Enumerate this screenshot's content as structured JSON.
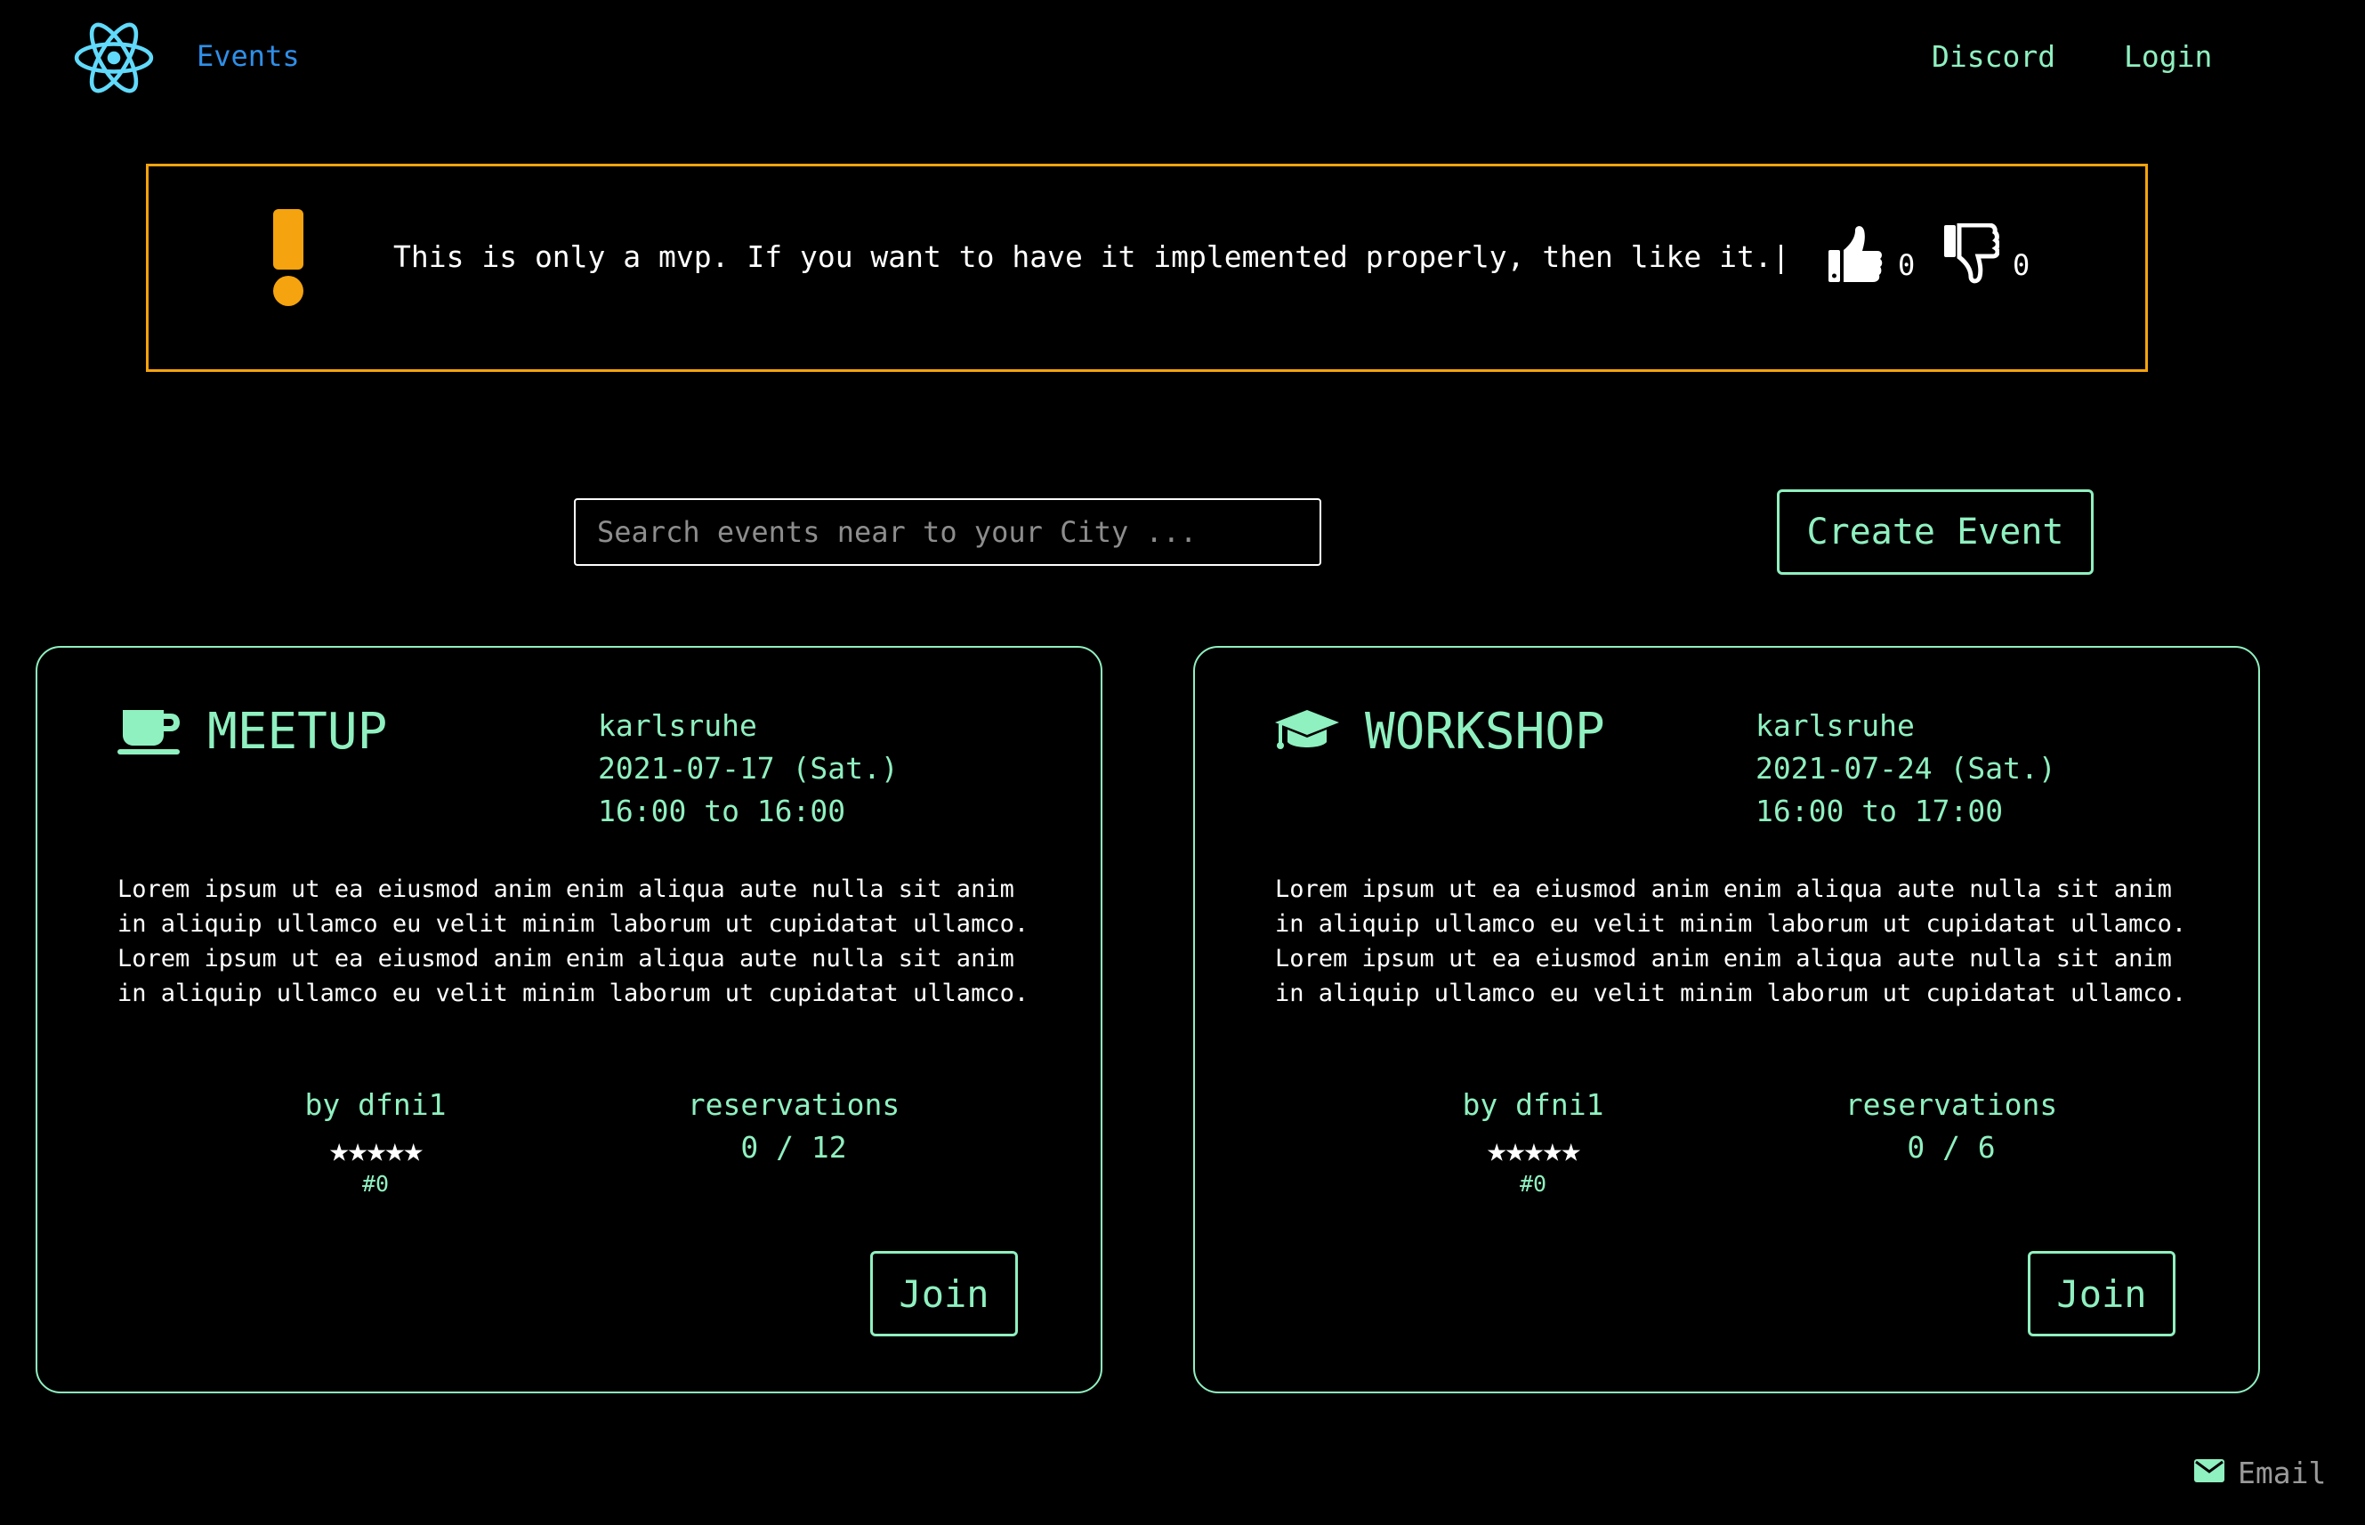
{
  "nav": {
    "logo_icon": "react-atom-icon",
    "events_label": "Events",
    "discord_label": "Discord",
    "login_label": "Login"
  },
  "banner": {
    "icon": "exclamation-icon",
    "message": "This is only a mvp. If you want to have it implemented properly, then like it.|",
    "likes": "0",
    "dislikes": "0"
  },
  "search": {
    "placeholder": "Search events near to your City ..."
  },
  "create_event_label": "Create Event",
  "events": [
    {
      "category_icon": "coffee-cup-icon",
      "category": "MEETUP",
      "location": "karlsruhe",
      "date": "2021-07-17 (Sat.)",
      "time": "16:00 to 16:00",
      "description": "Lorem ipsum ut ea eiusmod anim enim aliqua aute nulla sit anim\nin aliquip ullamco eu velit minim laborum ut cupidatat ullamco.\nLorem ipsum ut ea eiusmod anim enim aliqua aute nulla sit anim\nin aliquip ullamco eu velit minim laborum ut cupidatat ullamco.",
      "author": "by dfni1",
      "stars": "★★★★★",
      "rating_count": "#0",
      "reservations_label": "reservations",
      "reservations": "0 / 12",
      "join_label": "Join"
    },
    {
      "category_icon": "graduation-cap-icon",
      "category": "WORKSHOP",
      "location": "karlsruhe",
      "date": "2021-07-24 (Sat.)",
      "time": "16:00 to 17:00",
      "description": "Lorem ipsum ut ea eiusmod anim enim aliqua aute nulla sit anim\nin aliquip ullamco eu velit minim laborum ut cupidatat ullamco.\nLorem ipsum ut ea eiusmod anim enim aliqua aute nulla sit anim\nin aliquip ullamco eu velit minim laborum ut cupidatat ullamco.",
      "author": "by dfni1",
      "stars": "★★★★★",
      "rating_count": "#0",
      "reservations_label": "reservations",
      "reservations": "0 / 6",
      "join_label": "Join"
    }
  ],
  "footer": {
    "email_icon": "envelope-icon",
    "email_label": "Email"
  },
  "colors": {
    "accent": "#8ff0c0",
    "link": "#2f8fe8",
    "warning": "#f5a30e",
    "background": "#000000"
  }
}
